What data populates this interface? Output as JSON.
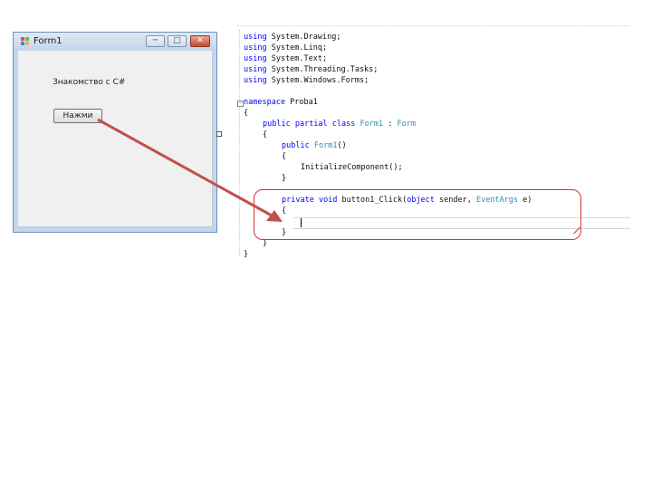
{
  "window": {
    "title": "Form1",
    "minimize_glyph": "─",
    "maximize_glyph": "□",
    "close_glyph": "✕",
    "label_text": "Знакомство с C#",
    "button_label": "Нажми"
  },
  "code": {
    "lines": [
      "using System.Drawing;",
      "using System.Linq;",
      "using System.Text;",
      "using System.Threading.Tasks;",
      "using System.Windows.Forms;",
      "namespace Proba1",
      "{",
      "public partial class Form1 : Form",
      "{",
      "public Form1()",
      "{",
      "InitializeComponent();",
      "}",
      "private void button1_Click(object sender, EventArgs e)",
      "{",
      "}",
      "}",
      "}"
    ]
  },
  "colors": {
    "keyword": "#0000ff",
    "type": "#2b91af",
    "arrow": "#c0504d",
    "highlight": "#d03535"
  },
  "icons": {
    "app": "form-app-icon",
    "arrow": "navigation-arrow"
  }
}
